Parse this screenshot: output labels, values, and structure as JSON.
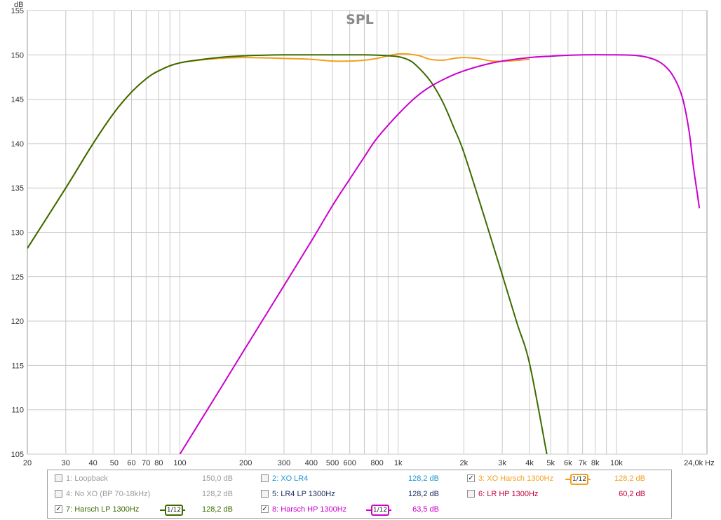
{
  "chart_data": {
    "type": "line",
    "title": "SPL",
    "xlabel": "Hz",
    "ylabel": "dB",
    "x_scale": "log",
    "xlim": [
      20,
      26000
    ],
    "ylim": [
      105,
      155
    ],
    "grid": true,
    "x_ticks": [
      20,
      30,
      40,
      50,
      60,
      70,
      80,
      100,
      200,
      300,
      400,
      500,
      600,
      800,
      1000,
      2000,
      3000,
      4000,
      5000,
      6000,
      7000,
      8000,
      10000,
      24000
    ],
    "x_tick_labels": [
      "20",
      "30",
      "40",
      "50",
      "60",
      "70",
      "80",
      "100",
      "200",
      "300",
      "400",
      "500",
      "600",
      "800",
      "1k",
      "2k",
      "3k",
      "4k",
      "5k",
      "6k",
      "7k",
      "8k",
      "10k",
      "24,0k Hz"
    ],
    "y_ticks": [
      105,
      110,
      115,
      120,
      125,
      130,
      135,
      140,
      145,
      150,
      155
    ],
    "y_tick_labels": [
      "105",
      "110",
      "115",
      "120",
      "125",
      "130",
      "135",
      "140",
      "145",
      "150",
      "155"
    ],
    "series": [
      {
        "name": "3: XO Harsch 1300Hz",
        "color": "#f2a01c",
        "points": [
          [
            20,
            128.2
          ],
          [
            30,
            135
          ],
          [
            40,
            140
          ],
          [
            50,
            143.5
          ],
          [
            60,
            145.8
          ],
          [
            70,
            147.3
          ],
          [
            80,
            148.2
          ],
          [
            100,
            149.1
          ],
          [
            150,
            149.6
          ],
          [
            200,
            149.7
          ],
          [
            300,
            149.6
          ],
          [
            400,
            149.5
          ],
          [
            500,
            149.3
          ],
          [
            600,
            149.3
          ],
          [
            700,
            149.4
          ],
          [
            800,
            149.6
          ],
          [
            900,
            149.9
          ],
          [
            1000,
            150.1
          ],
          [
            1100,
            150.1
          ],
          [
            1250,
            149.9
          ],
          [
            1400,
            149.5
          ],
          [
            1600,
            149.4
          ],
          [
            1800,
            149.6
          ],
          [
            2000,
            149.7
          ],
          [
            2300,
            149.6
          ],
          [
            2700,
            149.3
          ],
          [
            3200,
            149.3
          ],
          [
            4000,
            149.5
          ]
        ]
      },
      {
        "name": "7: Harsch LP 1300Hz",
        "color": "#3d6b00",
        "points": [
          [
            20,
            128.2
          ],
          [
            30,
            135
          ],
          [
            40,
            140
          ],
          [
            50,
            143.5
          ],
          [
            60,
            145.8
          ],
          [
            70,
            147.3
          ],
          [
            80,
            148.2
          ],
          [
            100,
            149.1
          ],
          [
            150,
            149.7
          ],
          [
            200,
            149.9
          ],
          [
            300,
            150
          ],
          [
            500,
            150
          ],
          [
            700,
            150
          ],
          [
            900,
            149.9
          ],
          [
            1000,
            149.8
          ],
          [
            1100,
            149.5
          ],
          [
            1200,
            148.9
          ],
          [
            1400,
            147.1
          ],
          [
            1600,
            144.7
          ],
          [
            1800,
            141.8
          ],
          [
            2000,
            139
          ],
          [
            2500,
            131.5
          ],
          [
            3000,
            125.2
          ],
          [
            3500,
            119.8
          ],
          [
            4000,
            115.2
          ],
          [
            4800,
            105
          ]
        ]
      },
      {
        "name": "8: Harsch HP 1300Hz",
        "color": "#cc00cc",
        "points": [
          [
            100,
            105
          ],
          [
            150,
            112
          ],
          [
            200,
            117
          ],
          [
            300,
            124
          ],
          [
            400,
            129
          ],
          [
            500,
            133
          ],
          [
            600,
            136
          ],
          [
            700,
            138.5
          ],
          [
            800,
            140.6
          ],
          [
            1000,
            143.3
          ],
          [
            1200,
            145.2
          ],
          [
            1400,
            146.4
          ],
          [
            1700,
            147.5
          ],
          [
            2000,
            148.2
          ],
          [
            2500,
            148.9
          ],
          [
            3000,
            149.3
          ],
          [
            4000,
            149.7
          ],
          [
            5000,
            149.85
          ],
          [
            7000,
            150
          ],
          [
            10000,
            150
          ],
          [
            12000,
            149.95
          ],
          [
            14000,
            149.7
          ],
          [
            16000,
            149.1
          ],
          [
            18000,
            147.8
          ],
          [
            20000,
            145.3
          ],
          [
            21500,
            141.5
          ],
          [
            22500,
            137.5
          ],
          [
            23500,
            134.3
          ],
          [
            24000,
            132.7
          ]
        ]
      }
    ]
  },
  "legend": {
    "items": [
      {
        "label": "1: Loopback",
        "value": "150,0 dB",
        "checked": false,
        "color": "#9a9a9a",
        "smoothing": ""
      },
      {
        "label": "2: XO LR4",
        "value": "128,2 dB",
        "checked": false,
        "color": "#1e96d2",
        "smoothing": ""
      },
      {
        "label": "3: XO Harsch 1300Hz",
        "value": "128,2 dB",
        "checked": true,
        "color": "#f2a01c",
        "smoothing": "1/12"
      },
      {
        "label": "4: No XO (BP 70-18kHz)",
        "value": "128,2 dB",
        "checked": false,
        "color": "#9a9a9a",
        "smoothing": ""
      },
      {
        "label": "5: LR4 LP 1300Hz",
        "value": "128,2 dB",
        "checked": false,
        "color": "#1a2a5a",
        "smoothing": ""
      },
      {
        "label": "6: LR HP 1300Hz",
        "value": "60,2 dB",
        "checked": false,
        "color": "#c0003a",
        "smoothing": ""
      },
      {
        "label": "7: Harsch LP 1300Hz",
        "value": "128,2 dB",
        "checked": true,
        "color": "#3d6b00",
        "smoothing": "1/12"
      },
      {
        "label": "8: Harsch HP 1300Hz",
        "value": "63,5 dB",
        "checked": true,
        "color": "#cc00cc",
        "smoothing": "1/12"
      }
    ]
  }
}
